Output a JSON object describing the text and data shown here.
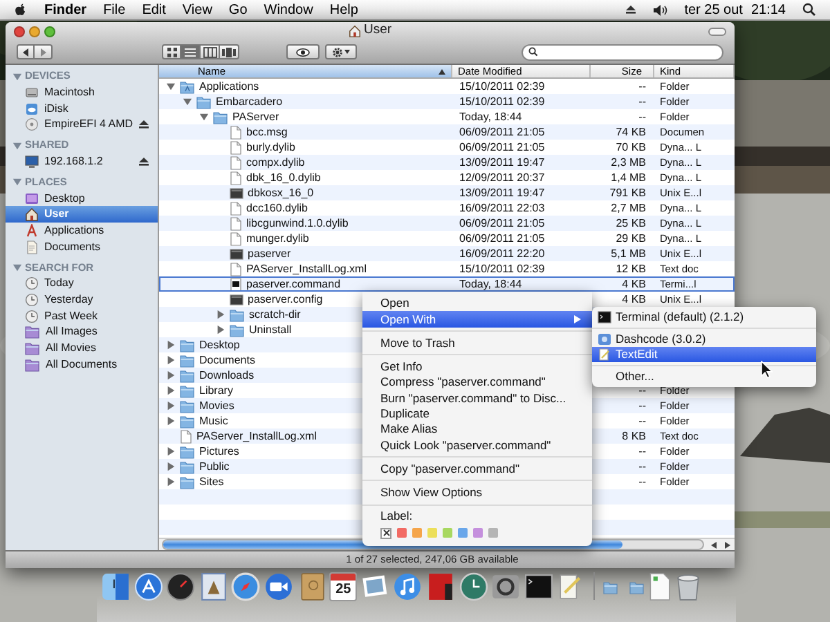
{
  "menu_bar": {
    "app": "Finder",
    "menus": [
      "File",
      "Edit",
      "View",
      "Go",
      "Window",
      "Help"
    ],
    "date": "ter 25 out",
    "time": "21:14"
  },
  "window": {
    "title": "User",
    "view_modes": [
      {
        "kind": "icons",
        "selected": false
      },
      {
        "kind": "list",
        "selected": true
      },
      {
        "kind": "columns",
        "selected": false
      },
      {
        "kind": "cover-flow",
        "selected": false
      }
    ],
    "sidebar": [
      {
        "title": "DEVICES",
        "expanded": true,
        "items": [
          {
            "label": "Macintosh",
            "kind": "drive",
            "selected": false,
            "ejectable": false
          },
          {
            "label": "iDisk",
            "kind": "idisk",
            "selected": false,
            "ejectable": false
          },
          {
            "label": "EmpireEFI 4 AMD",
            "kind": "disc",
            "selected": false,
            "ejectable": true
          }
        ]
      },
      {
        "title": "SHARED",
        "expanded": true,
        "items": [
          {
            "label": "192.168.1.2",
            "kind": "network",
            "selected": false,
            "ejectable": true
          }
        ]
      },
      {
        "title": "PLACES",
        "expanded": true,
        "items": [
          {
            "label": "Desktop",
            "kind": "desktop",
            "selected": false,
            "ejectable": false
          },
          {
            "label": "User",
            "kind": "home",
            "selected": true,
            "ejectable": false
          },
          {
            "label": "Applications",
            "kind": "applications",
            "selected": false,
            "ejectable": false
          },
          {
            "label": "Documents",
            "kind": "documents",
            "selected": false,
            "ejectable": false
          }
        ]
      },
      {
        "title": "SEARCH FOR",
        "expanded": true,
        "items": [
          {
            "label": "Today",
            "kind": "clock",
            "selected": false,
            "ejectable": false
          },
          {
            "label": "Yesterday",
            "kind": "clock",
            "selected": false,
            "ejectable": false
          },
          {
            "label": "Past Week",
            "kind": "clock",
            "selected": false,
            "ejectable": false
          },
          {
            "label": "All Images",
            "kind": "smart-folder",
            "selected": false,
            "ejectable": false
          },
          {
            "label": "All Movies",
            "kind": "smart-folder",
            "selected": false,
            "ejectable": false
          },
          {
            "label": "All Documents",
            "kind": "smart-folder",
            "selected": false,
            "ejectable": false
          }
        ]
      }
    ],
    "columns": [
      {
        "label": "Name",
        "sorted": true
      },
      {
        "label": "Date Modified",
        "sorted": false
      },
      {
        "label": "Size",
        "sorted": false
      },
      {
        "label": "Kind",
        "sorted": false
      }
    ],
    "rows": [
      {
        "name": "Applications",
        "kind": "app-folder",
        "expanded": true,
        "selected": false,
        "date": "15/10/2011 02:39",
        "size": "--",
        "type": "Folder",
        "children": [
          {
            "name": "Embarcadero",
            "kind": "folder",
            "expanded": true,
            "selected": false,
            "date": "15/10/2011 02:39",
            "size": "--",
            "type": "Folder",
            "children": [
              {
                "name": "PAServer",
                "kind": "folder",
                "expanded": true,
                "selected": false,
                "date": "Today, 18:44",
                "size": "--",
                "type": "Folder",
                "children": [
                  {
                    "name": "bcc.msg",
                    "kind": "document",
                    "selected": false,
                    "date": "06/09/2011 21:05",
                    "size": "74 KB",
                    "type": "Documen"
                  },
                  {
                    "name": "burly.dylib",
                    "kind": "document",
                    "selected": false,
                    "date": "06/09/2011 21:05",
                    "size": "70 KB",
                    "type": "Dyna... L"
                  },
                  {
                    "name": "compx.dylib",
                    "kind": "document",
                    "selected": false,
                    "date": "13/09/2011 19:47",
                    "size": "2,3 MB",
                    "type": "Dyna... L"
                  },
                  {
                    "name": "dbk_16_0.dylib",
                    "kind": "document",
                    "selected": false,
                    "date": "12/09/2011 20:37",
                    "size": "1,4 MB",
                    "type": "Dyna... L"
                  },
                  {
                    "name": "dbkosx_16_0",
                    "kind": "executable",
                    "selected": false,
                    "date": "13/09/2011 19:47",
                    "size": "791 KB",
                    "type": "Unix E...l"
                  },
                  {
                    "name": "dcc160.dylib",
                    "kind": "document",
                    "selected": false,
                    "date": "16/09/2011 22:03",
                    "size": "2,7 MB",
                    "type": "Dyna... L"
                  },
                  {
                    "name": "libcgunwind.1.0.dylib",
                    "kind": "document",
                    "selected": false,
                    "date": "06/09/2011 21:05",
                    "size": "25 KB",
                    "type": "Dyna... L"
                  },
                  {
                    "name": "munger.dylib",
                    "kind": "document",
                    "selected": false,
                    "date": "06/09/2011 21:05",
                    "size": "29 KB",
                    "type": "Dyna... L"
                  },
                  {
                    "name": "paserver",
                    "kind": "executable",
                    "selected": false,
                    "date": "16/09/2011 22:20",
                    "size": "5,1 MB",
                    "type": "Unix E...l"
                  },
                  {
                    "name": "PAServer_InstallLog.xml",
                    "kind": "document",
                    "selected": false,
                    "date": "15/10/2011 02:39",
                    "size": "12 KB",
                    "type": "Text doc"
                  },
                  {
                    "name": "paserver.command",
                    "kind": "script",
                    "selected": true,
                    "date": "Today, 18:44",
                    "size": "4 KB",
                    "type": "Termi...l"
                  },
                  {
                    "name": "paserver.config",
                    "kind": "executable",
                    "selected": false,
                    "size": "4 KB",
                    "type": "Unix E...l"
                  },
                  {
                    "name": "scratch-dir",
                    "kind": "folder",
                    "expanded": false,
                    "selected": false
                  },
                  {
                    "name": "Uninstall",
                    "kind": "folder",
                    "expanded": false,
                    "selected": false
                  }
                ]
              }
            ]
          }
        ]
      },
      {
        "name": "Desktop",
        "kind": "folder",
        "expanded": false,
        "selected": false
      },
      {
        "name": "Documents",
        "kind": "folder",
        "expanded": false,
        "selected": false
      },
      {
        "name": "Downloads",
        "kind": "folder",
        "expanded": false,
        "selected": false
      },
      {
        "name": "Library",
        "kind": "folder",
        "expanded": false,
        "selected": false,
        "size": "--",
        "type": "Folder"
      },
      {
        "name": "Movies",
        "kind": "folder",
        "expanded": false,
        "selected": false,
        "size": "--",
        "type": "Folder"
      },
      {
        "name": "Music",
        "kind": "folder",
        "expanded": false,
        "selected": false,
        "size": "--",
        "type": "Folder"
      },
      {
        "name": "PAServer_InstallLog.xml",
        "kind": "document",
        "selected": false,
        "size": "8 KB",
        "type": "Text doc"
      },
      {
        "name": "Pictures",
        "kind": "folder",
        "expanded": false,
        "selected": false,
        "size": "--",
        "type": "Folder"
      },
      {
        "name": "Public",
        "kind": "folder",
        "expanded": false,
        "selected": false,
        "size": "--",
        "type": "Folder"
      },
      {
        "name": "Sites",
        "kind": "folder",
        "expanded": false,
        "selected": false,
        "size": "--",
        "type": "Folder"
      }
    ],
    "status_bar": "1 of 27 selected, 247,06 GB available"
  },
  "context_menu": {
    "items": [
      {
        "kind": "item",
        "label": "Open",
        "selected": false
      },
      {
        "kind": "submenu",
        "label": "Open With",
        "selected": true
      },
      {
        "kind": "separator"
      },
      {
        "kind": "item",
        "label": "Move to Trash",
        "selected": false
      },
      {
        "kind": "separator"
      },
      {
        "kind": "item",
        "label": "Get Info",
        "selected": false
      },
      {
        "kind": "item",
        "label": "Compress \"paserver.command\"",
        "selected": false
      },
      {
        "kind": "item",
        "label": "Burn \"paserver.command\" to Disc...",
        "selected": false
      },
      {
        "kind": "item",
        "label": "Duplicate",
        "selected": false
      },
      {
        "kind": "item",
        "label": "Make Alias",
        "selected": false
      },
      {
        "kind": "item",
        "label": "Quick Look \"paserver.command\"",
        "selected": false
      },
      {
        "kind": "separator"
      },
      {
        "kind": "item",
        "label": "Copy \"paserver.command\"",
        "selected": false
      },
      {
        "kind": "separator"
      },
      {
        "kind": "item",
        "label": "Show View Options",
        "selected": false
      },
      {
        "kind": "separator"
      },
      {
        "kind": "heading",
        "label": "Label:"
      },
      {
        "kind": "labels",
        "labels": [
          {
            "kind": "none"
          },
          {
            "kind": "color",
            "color": "#f26b64"
          },
          {
            "kind": "color",
            "color": "#f5a54a"
          },
          {
            "kind": "color",
            "color": "#ecdf5a"
          },
          {
            "kind": "color",
            "color": "#a8d860"
          },
          {
            "kind": "color",
            "color": "#6aa7ea"
          },
          {
            "kind": "color",
            "color": "#c590dd"
          },
          {
            "kind": "color",
            "color": "#b5b5b5"
          }
        ]
      }
    ]
  },
  "submenu": {
    "items": [
      {
        "kind": "terminal",
        "label": "Terminal (default) (2.1.2)",
        "selected": false
      },
      {
        "kind": "separator"
      },
      {
        "kind": "dashcode",
        "label": "Dashcode (3.0.2)",
        "selected": false
      },
      {
        "kind": "textedit",
        "label": "TextEdit",
        "selected": true
      },
      {
        "kind": "separator"
      },
      {
        "kind": "other",
        "label": "Other...",
        "selected": false
      }
    ]
  },
  "dock": {
    "calendar_day": "25"
  }
}
